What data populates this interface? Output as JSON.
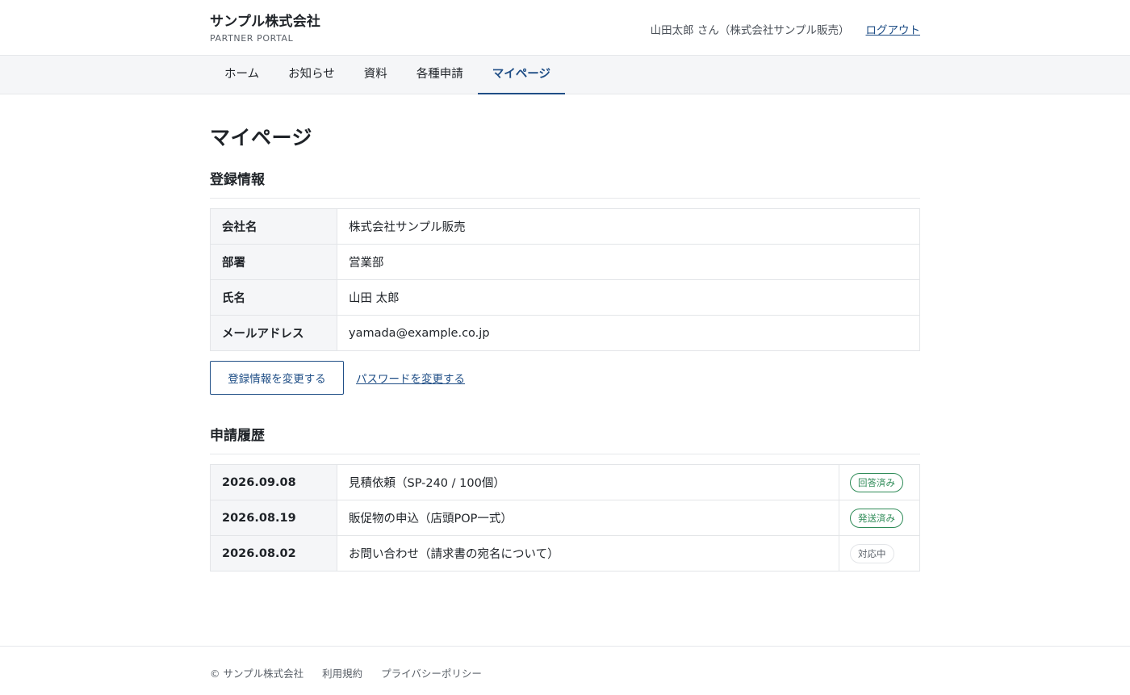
{
  "header": {
    "brand_name": "サンプル株式会社",
    "brand_sub": "PARTNER PORTAL",
    "user_label": "山田太郎 さん（株式会社サンプル販売）",
    "logout_label": "ログアウト"
  },
  "nav": {
    "items": [
      {
        "label": "ホーム"
      },
      {
        "label": "お知らせ"
      },
      {
        "label": "資料"
      },
      {
        "label": "各種申請"
      },
      {
        "label": "マイページ"
      }
    ],
    "active": "マイページ"
  },
  "page": {
    "title": "マイページ"
  },
  "registration": {
    "section_title": "登録情報",
    "rows": [
      {
        "label": "会社名",
        "value": "株式会社サンプル販売"
      },
      {
        "label": "部署",
        "value": "営業部"
      },
      {
        "label": "氏名",
        "value": "山田 太郎"
      },
      {
        "label": "メールアドレス",
        "value": "yamada@example.co.jp"
      }
    ],
    "edit_button_label": "登録情報を変更する",
    "password_link_label": "パスワードを変更する"
  },
  "history": {
    "section_title": "申請履歴",
    "rows": [
      {
        "date": "2026.09.08",
        "title": "見積依頼（SP-240 / 100個）",
        "status": "回答済み"
      },
      {
        "date": "2026.08.19",
        "title": "販促物の申込（店頭POP一式）",
        "status": "発送済み"
      },
      {
        "date": "2026.08.02",
        "title": "お問い合わせ（請求書の宛名について）",
        "status": "対応中"
      }
    ]
  },
  "footer": {
    "copyright": "© サンプル株式会社",
    "terms_label": "利用規約",
    "privacy_label": "プライバシーポリシー"
  },
  "colors": {
    "accent": "#1f4e86",
    "status_done": "#2e8b57",
    "surface": "#f5f6f8",
    "border": "#e3e5e8"
  }
}
